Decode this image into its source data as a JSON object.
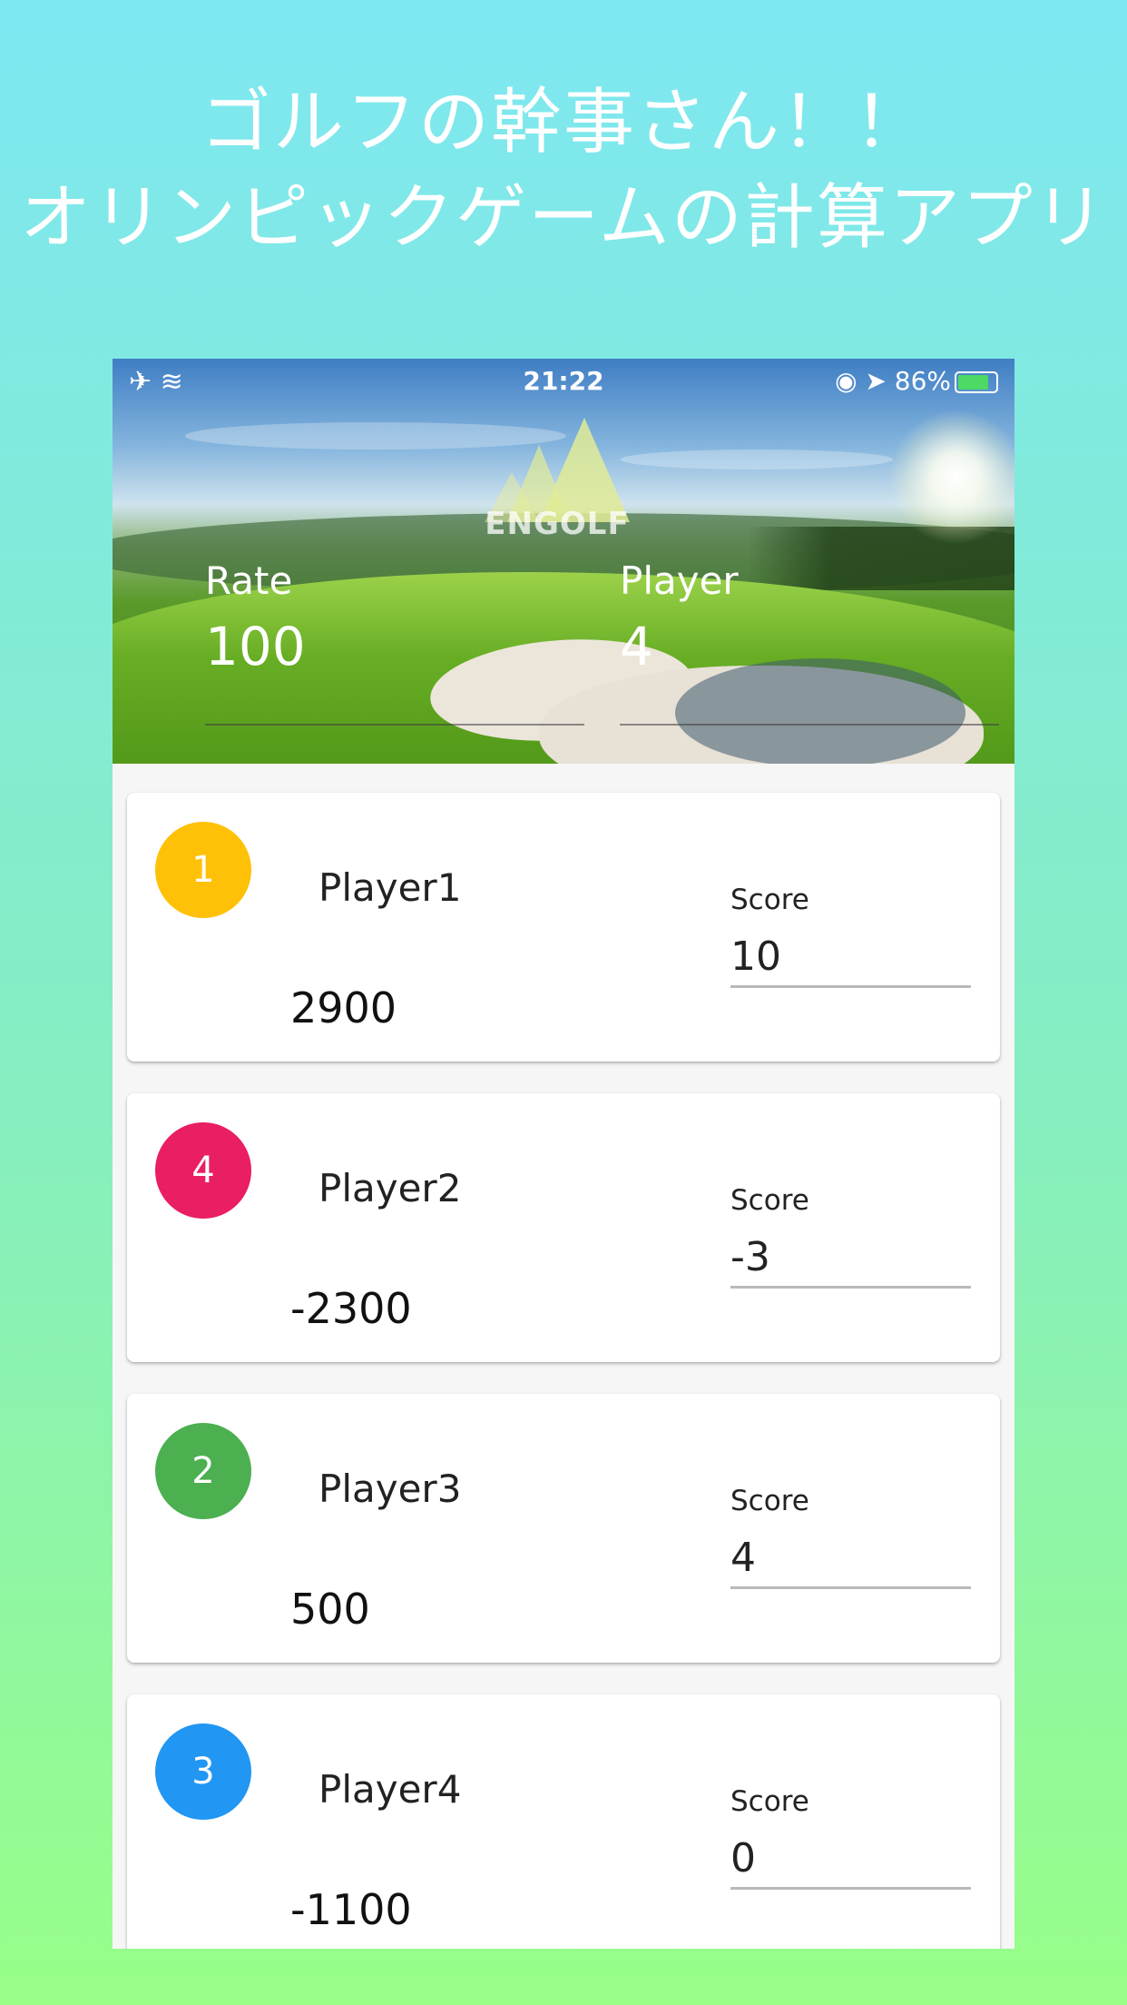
{
  "promo": {
    "title_line1": "ゴルフの幹事さん！！",
    "title_line2": "オリンピックゲームの計算アプリ"
  },
  "status_bar": {
    "left_icons": "✈ ≋",
    "time": "21:22",
    "right_text": "◉ ➤ 86%",
    "battery_percent": 86
  },
  "header": {
    "logo_text": "ENGOLF",
    "rate_label": "Rate",
    "rate_value": "100",
    "player_label": "Player",
    "player_value": "4"
  },
  "players": [
    {
      "rank": "1",
      "rank_color": "#FFC107",
      "name": "Player1",
      "score_label": "Score",
      "score": "10",
      "points": "2900"
    },
    {
      "rank": "4",
      "rank_color": "#E91E63",
      "name": "Player2",
      "score_label": "Score",
      "score": "-3",
      "points": "-2300"
    },
    {
      "rank": "2",
      "rank_color": "#4CAF50",
      "name": "Player3",
      "score_label": "Score",
      "score": "4",
      "points": "500"
    },
    {
      "rank": "3",
      "rank_color": "#2196F3",
      "name": "Player4",
      "score_label": "Score",
      "score": "0",
      "points": "-1100"
    }
  ]
}
